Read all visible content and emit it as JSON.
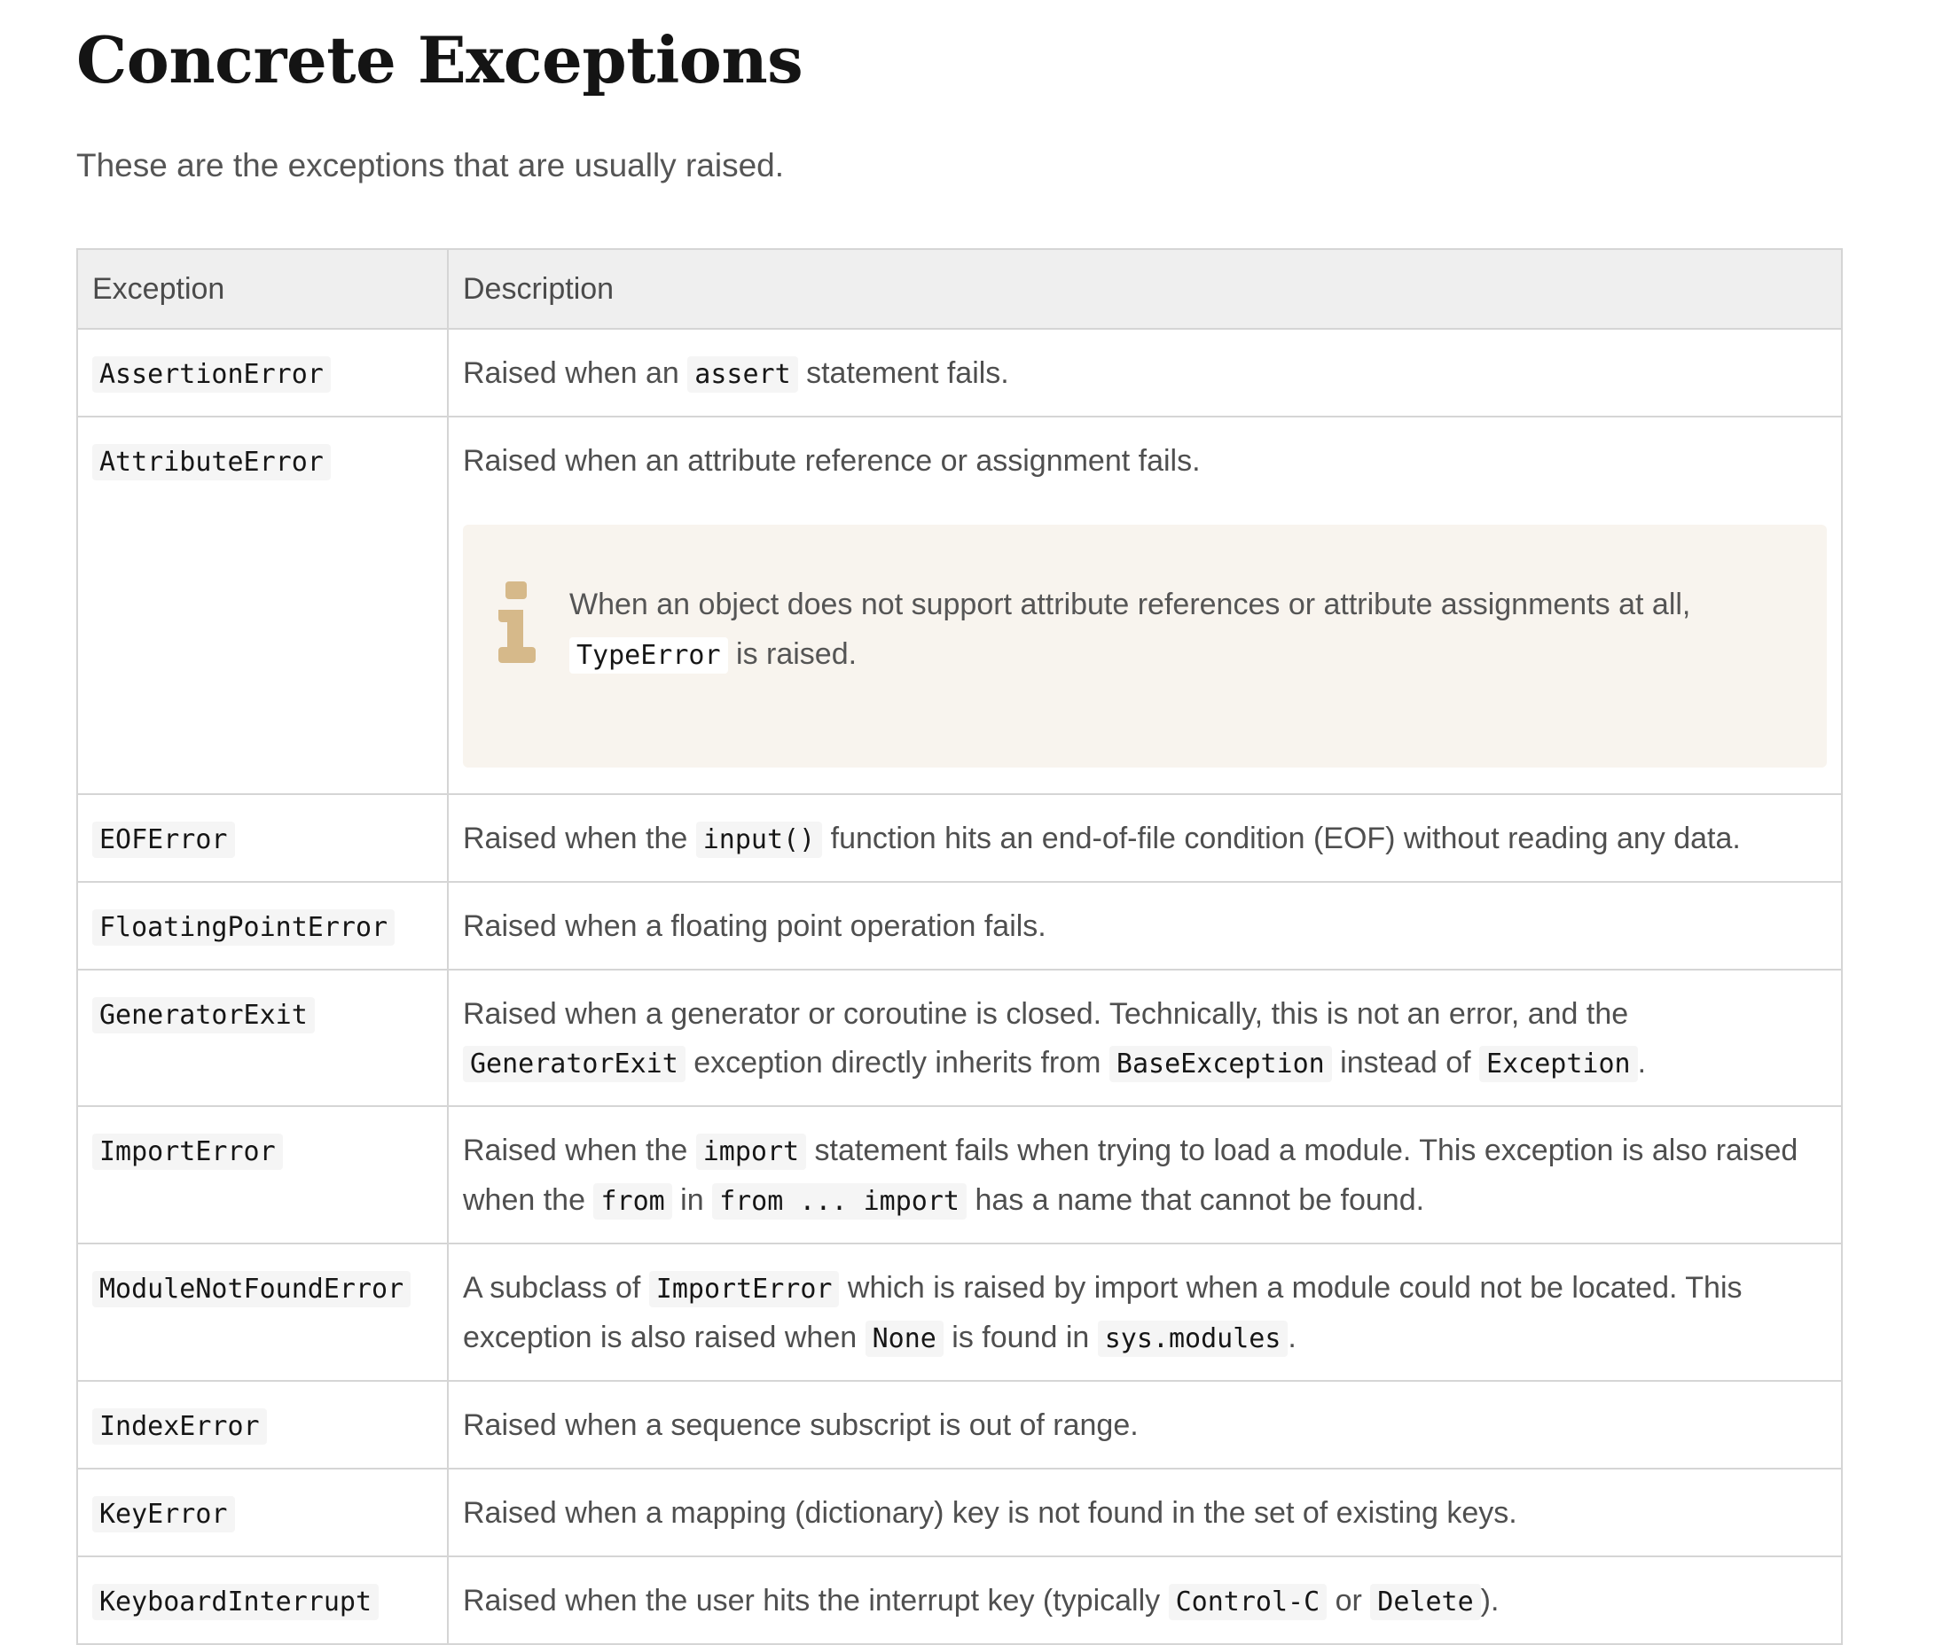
{
  "heading": "Concrete Exceptions",
  "intro": "These are the exceptions that are usually raised.",
  "table": {
    "headers": [
      "Exception",
      "Description"
    ],
    "rows": [
      {
        "name": "AssertionError",
        "parts": [
          "Raised when an ",
          "assert",
          " statement fails."
        ]
      },
      {
        "name": "AttributeError",
        "parts": [
          "Raised when an attribute reference or assignment fails."
        ],
        "note": {
          "icon": "info-icon",
          "parts": [
            "When an object does not support attribute references or attribute assignments at all, ",
            "TypeError",
            " is raised."
          ]
        }
      },
      {
        "name": "EOFError",
        "parts": [
          "Raised when the ",
          "input()",
          " function hits an end-of-file condition (EOF) without reading any data."
        ]
      },
      {
        "name": "FloatingPointError",
        "parts": [
          "Raised when a floating point operation fails."
        ]
      },
      {
        "name": "GeneratorExit",
        "parts": [
          "Raised when a generator or coroutine is closed. Technically, this is not an error, and the ",
          "GeneratorExit",
          " exception directly inherits from ",
          "BaseException",
          " instead of ",
          "Exception",
          "."
        ]
      },
      {
        "name": "ImportError",
        "parts": [
          "Raised when the ",
          "import",
          " statement fails when trying to load a module. This exception is also raised when the ",
          "from",
          " in ",
          "from ... import",
          " has a name that cannot be found."
        ]
      },
      {
        "name": "ModuleNotFoundError",
        "parts": [
          "A subclass of ",
          "ImportError",
          " which is raised by import when a module could not be located. This exception is also raised when ",
          "None",
          " is found in ",
          "sys.modules",
          "."
        ]
      },
      {
        "name": "IndexError",
        "parts": [
          "Raised when a sequence subscript is out of range."
        ]
      },
      {
        "name": "KeyError",
        "parts": [
          "Raised when a mapping (dictionary) key is not found in the set of existing keys."
        ]
      },
      {
        "name": "KeyboardInterrupt",
        "parts": [
          "Raised when the user hits the interrupt key (typically ",
          "Control-C",
          " or ",
          "Delete",
          ")."
        ]
      }
    ]
  }
}
